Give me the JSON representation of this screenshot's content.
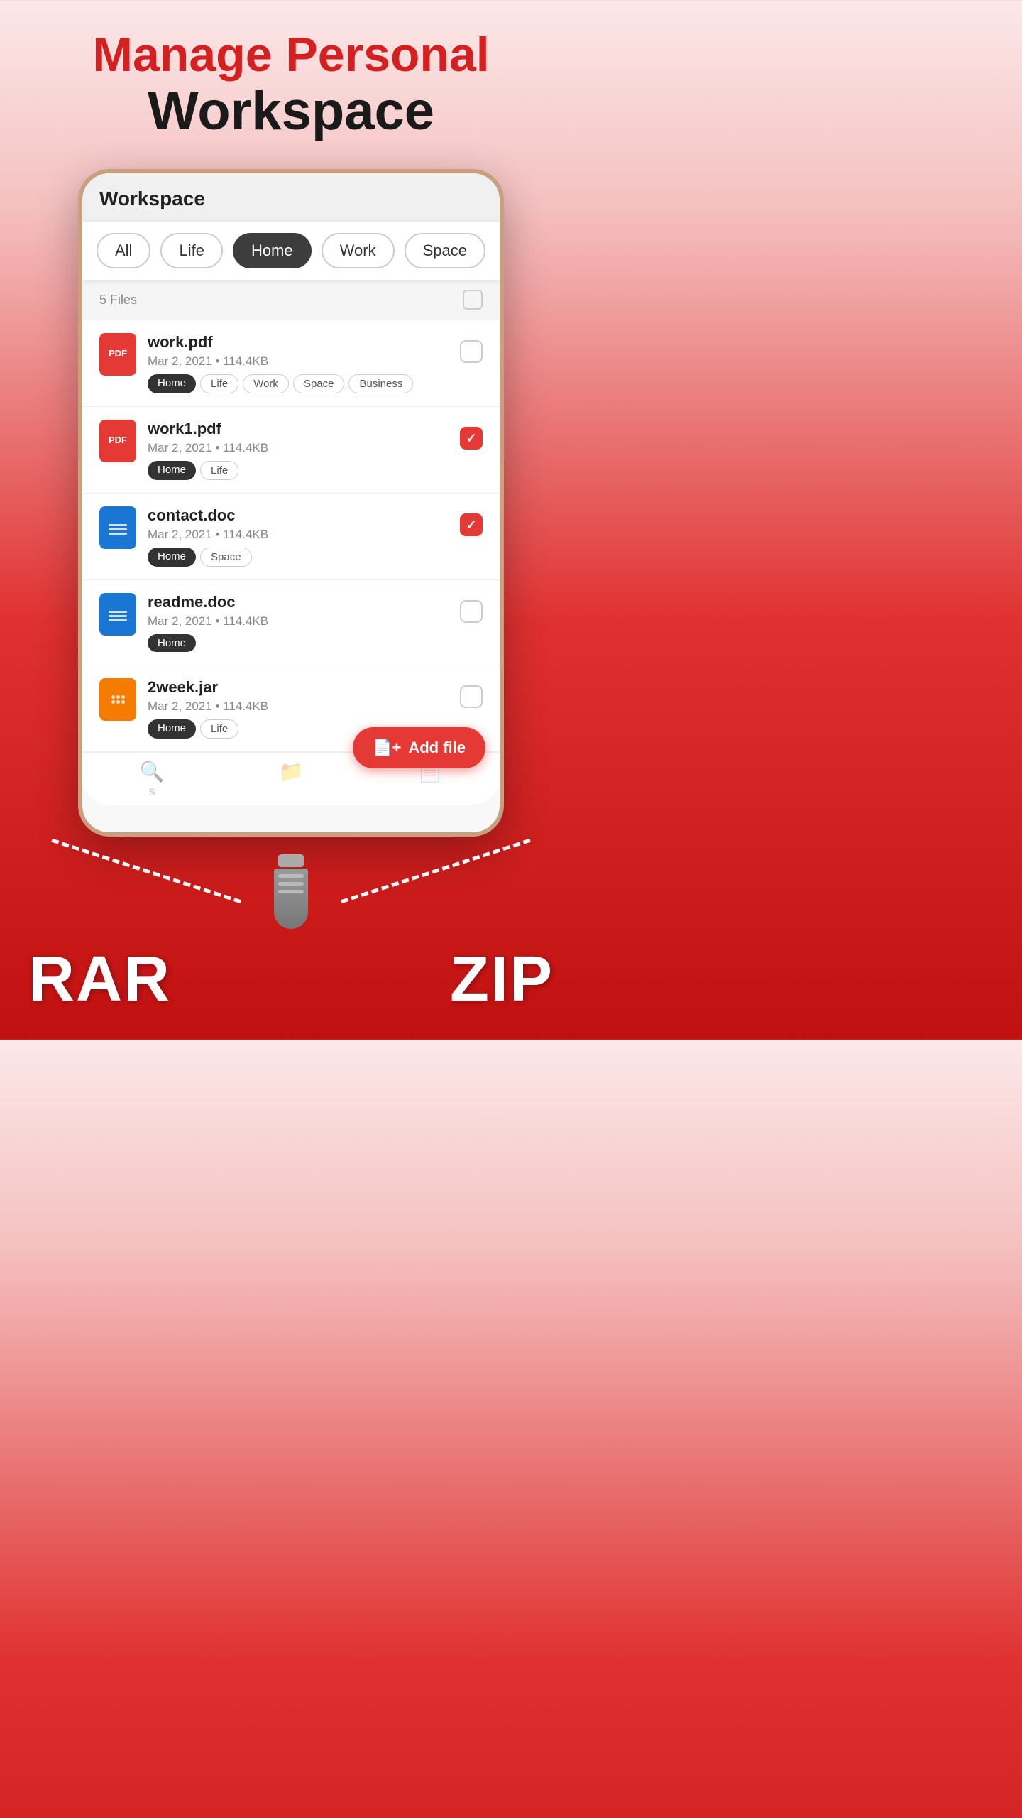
{
  "hero": {
    "line1": "Manage Personal",
    "line2": "Workspace"
  },
  "phone": {
    "header": "Workspace"
  },
  "filter": {
    "chips": [
      {
        "label": "All",
        "active": false
      },
      {
        "label": "Life",
        "active": false
      },
      {
        "label": "Home",
        "active": true
      },
      {
        "label": "Work",
        "active": false
      },
      {
        "label": "Space",
        "active": false
      }
    ]
  },
  "files": {
    "count_label": "5 Files",
    "items": [
      {
        "name": "work.pdf",
        "meta": "Mar 2, 2021 • 114.4KB",
        "type": "pdf",
        "checked": false,
        "tags": [
          {
            "label": "Home",
            "dark": true
          },
          {
            "label": "Life",
            "dark": false
          },
          {
            "label": "Work",
            "dark": false
          },
          {
            "label": "Space",
            "dark": false
          },
          {
            "label": "Business",
            "dark": false
          }
        ]
      },
      {
        "name": "work1.pdf",
        "meta": "Mar 2, 2021 • 114.4KB",
        "type": "pdf",
        "checked": true,
        "tags": [
          {
            "label": "Home",
            "dark": true
          },
          {
            "label": "Life",
            "dark": false
          }
        ]
      },
      {
        "name": "contact.doc",
        "meta": "Mar 2, 2021 • 114.4KB",
        "type": "doc",
        "checked": true,
        "tags": [
          {
            "label": "Home",
            "dark": true
          },
          {
            "label": "Space",
            "dark": false
          }
        ]
      },
      {
        "name": "readme.doc",
        "meta": "Mar 2, 2021 • 114.4KB",
        "type": "doc",
        "checked": false,
        "tags": [
          {
            "label": "Home",
            "dark": true
          }
        ]
      },
      {
        "name": "2week.jar",
        "meta": "Mar 2, 2021 • 114.4KB",
        "type": "jar",
        "checked": false,
        "tags": [
          {
            "label": "Home",
            "dark": true
          },
          {
            "label": "Life",
            "dark": false
          }
        ]
      }
    ]
  },
  "add_file_btn": {
    "label": "Add file",
    "icon": "+"
  },
  "bottom_nav": [
    {
      "label": "S",
      "icon": "🔍"
    },
    {
      "label": "",
      "icon": "📁"
    },
    {
      "label": "",
      "icon": "📄"
    }
  ],
  "bottom_labels": {
    "rar": "RAR",
    "zip": "ZIP"
  }
}
